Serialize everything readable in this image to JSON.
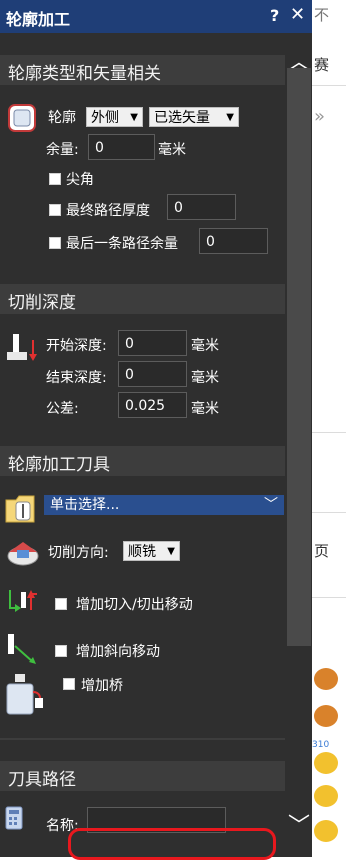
{
  "window": {
    "title": "轮廓加工",
    "help": "?",
    "close": "✕"
  },
  "sections": {
    "profile_type": "轮廓类型和矢量相关",
    "cut_depth": "切削深度",
    "contour_tool": "轮廓加工刀具",
    "toolpath": "刀具路径"
  },
  "profile": {
    "label": "轮廓",
    "side_value": "外侧",
    "vector_value": "已选矢量",
    "allowance_label": "余量:",
    "allowance_value": "0",
    "allowance_unit": "毫米",
    "sharp_corner_label": "尖角",
    "final_pass_label": "最终路径厚度",
    "final_pass_value": "0",
    "last_pass_label": "最后一条路径余量",
    "last_pass_value": "0"
  },
  "depth": {
    "start_label": "开始深度:",
    "start_value": "0",
    "start_unit": "毫米",
    "end_label": "结束深度:",
    "end_value": "0",
    "end_unit": "毫米",
    "tolerance_label": "公差:",
    "tolerance_value": "0.025",
    "tolerance_unit": "毫米"
  },
  "tool": {
    "select_value": "单击选择...",
    "direction_label": "切削方向:",
    "direction_value": "顺铣",
    "lead_label": "增加切入/切出移动",
    "ramp_label": "增加斜向移动",
    "bridge_label": "增加桥"
  },
  "toolpath": {
    "name_label": "名称:",
    "name_value": ""
  },
  "background": {
    "char1": "不",
    "char2": "赛",
    "char3": "»",
    "char4": "页",
    "badge": "310"
  },
  "colors": {
    "titlebar": "#1f3e77",
    "panel": "#2f2f2f",
    "accent_select": "#2a4f8f",
    "annotation": "#e8181e"
  }
}
